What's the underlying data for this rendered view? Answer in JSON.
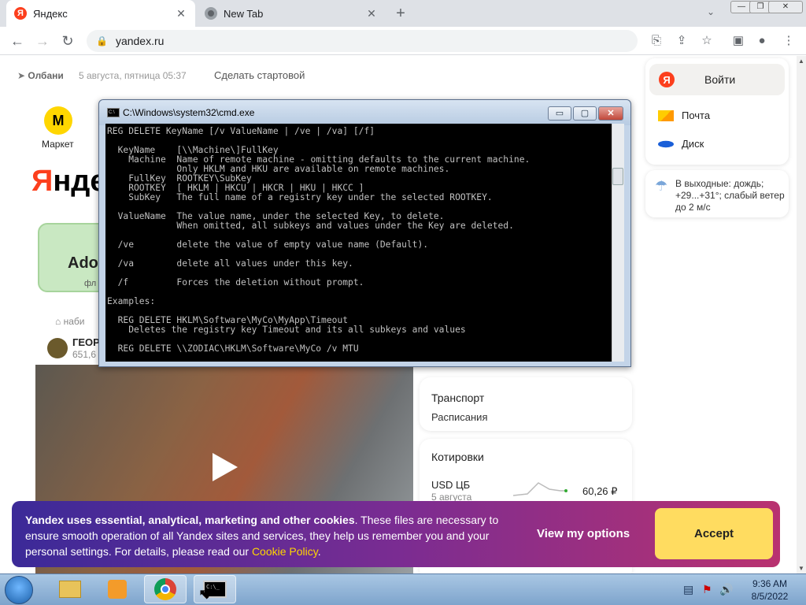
{
  "browser": {
    "tabs": [
      {
        "label": "Яндекс",
        "favicon": "yandex-icon",
        "active": true
      },
      {
        "label": "New Tab",
        "favicon": "chrome-icon",
        "active": false
      }
    ],
    "url": "yandex.ru"
  },
  "yandex": {
    "geo": "Олбани",
    "date": "5 августа, пятница 05:37",
    "homepage_link": "Сделать стартовой",
    "market_label": "Маркет",
    "logo_colored": "Я",
    "logo_rest": "нде",
    "ad_text": "Ado",
    "ad_sub": "фл",
    "feed_source": "наби",
    "feed_title": "ГЕОР",
    "feed_subs": "651,6",
    "login_label": "Войти",
    "services": [
      "Почта",
      "Диск"
    ],
    "weather": "В выходные: дождь; +29...+31°; слабый ветер до 2 м/с",
    "transport_title": "Транспорт",
    "transport_link": "Расписания",
    "quotes_title": "Котировки",
    "usd_label": "USD ЦБ",
    "usd_date": "5 августа",
    "usd_value": "60,26 ₽"
  },
  "cookie": {
    "bold": "Yandex uses essential, analytical, marketing and other cookies",
    "text": ". These files are necessary to ensure smooth operation of all Yandex sites and services, they help us remember you and your personal settings. For details, please read our ",
    "link": "Cookie Policy",
    "end": ".",
    "view_options": "View my options",
    "accept": "Accept"
  },
  "cmd": {
    "title": "C:\\Windows\\system32\\cmd.exe",
    "lines": "REG DELETE KeyName [/v ValueName | /ve | /va] [/f]\n\n  KeyName    [\\\\Machine\\]FullKey\n    Machine  Name of remote machine - omitting defaults to the current machine.\n             Only HKLM and HKU are available on remote machines.\n    FullKey  ROOTKEY\\SubKey\n    ROOTKEY  [ HKLM | HKCU | HKCR | HKU | HKCC ]\n    SubKey   The full name of a registry key under the selected ROOTKEY.\n\n  ValueName  The value name, under the selected Key, to delete.\n             When omitted, all subkeys and values under the Key are deleted.\n\n  /ve        delete the value of empty value name (Default).\n\n  /va        delete all values under this key.\n\n  /f         Forces the deletion without prompt.\n\nExamples:\n\n  REG DELETE HKLM\\Software\\MyCo\\MyApp\\Timeout\n    Deletes the registry key Timeout and its all subkeys and values\n\n  REG DELETE \\\\ZODIAC\\HKLM\\Software\\MyCo /v MTU"
  },
  "taskbar": {
    "time": "9:36 AM",
    "date": "8/5/2022"
  }
}
